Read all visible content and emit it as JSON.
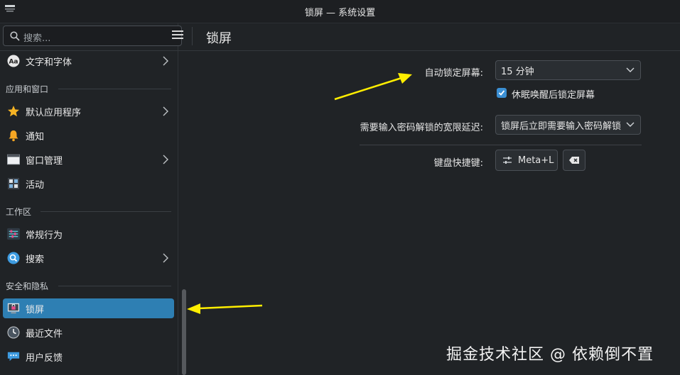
{
  "window": {
    "title": "锁屏 — 系统设置"
  },
  "search": {
    "placeholder": "搜索..."
  },
  "header": {
    "title": "锁屏"
  },
  "sidebar": {
    "items": [
      {
        "label": "文字和字体",
        "icon": "font-aa-icon",
        "chevron": true
      },
      {
        "section": "应用和窗口"
      },
      {
        "label": "默认应用程序",
        "icon": "star-icon",
        "chevron": true
      },
      {
        "label": "通知",
        "icon": "bell-icon",
        "chevron": false
      },
      {
        "label": "窗口管理",
        "icon": "window-icon",
        "chevron": true
      },
      {
        "label": "活动",
        "icon": "activities-icon",
        "chevron": false
      },
      {
        "section": "工作区"
      },
      {
        "label": "常规行为",
        "icon": "sliders-icon",
        "chevron": false
      },
      {
        "label": "搜索",
        "icon": "magnifier-icon",
        "chevron": true
      },
      {
        "section": "安全和隐私"
      },
      {
        "label": "锁屏",
        "icon": "lock-screen-icon",
        "chevron": false,
        "active": true
      },
      {
        "label": "最近文件",
        "icon": "clock-icon",
        "chevron": false
      },
      {
        "label": "用户反馈",
        "icon": "feedback-icon",
        "chevron": false
      }
    ]
  },
  "settings": {
    "autolock_label": "自动锁定屏幕:",
    "autolock_value": "15 分钟",
    "resume_lock_label": "休眠唤醒后锁定屏幕",
    "resume_lock_checked": true,
    "grace_label": "需要输入密码解锁的宽限延迟:",
    "grace_value": "锁屏后立即需要输入密码解锁",
    "shortcut_label": "键盘快捷键:",
    "shortcut_value": "Meta+L"
  },
  "watermark": "掘金技术社区 @ 依赖倒不置",
  "colors": {
    "accent": "#2e7fb3",
    "annotation": "#ffee00"
  }
}
